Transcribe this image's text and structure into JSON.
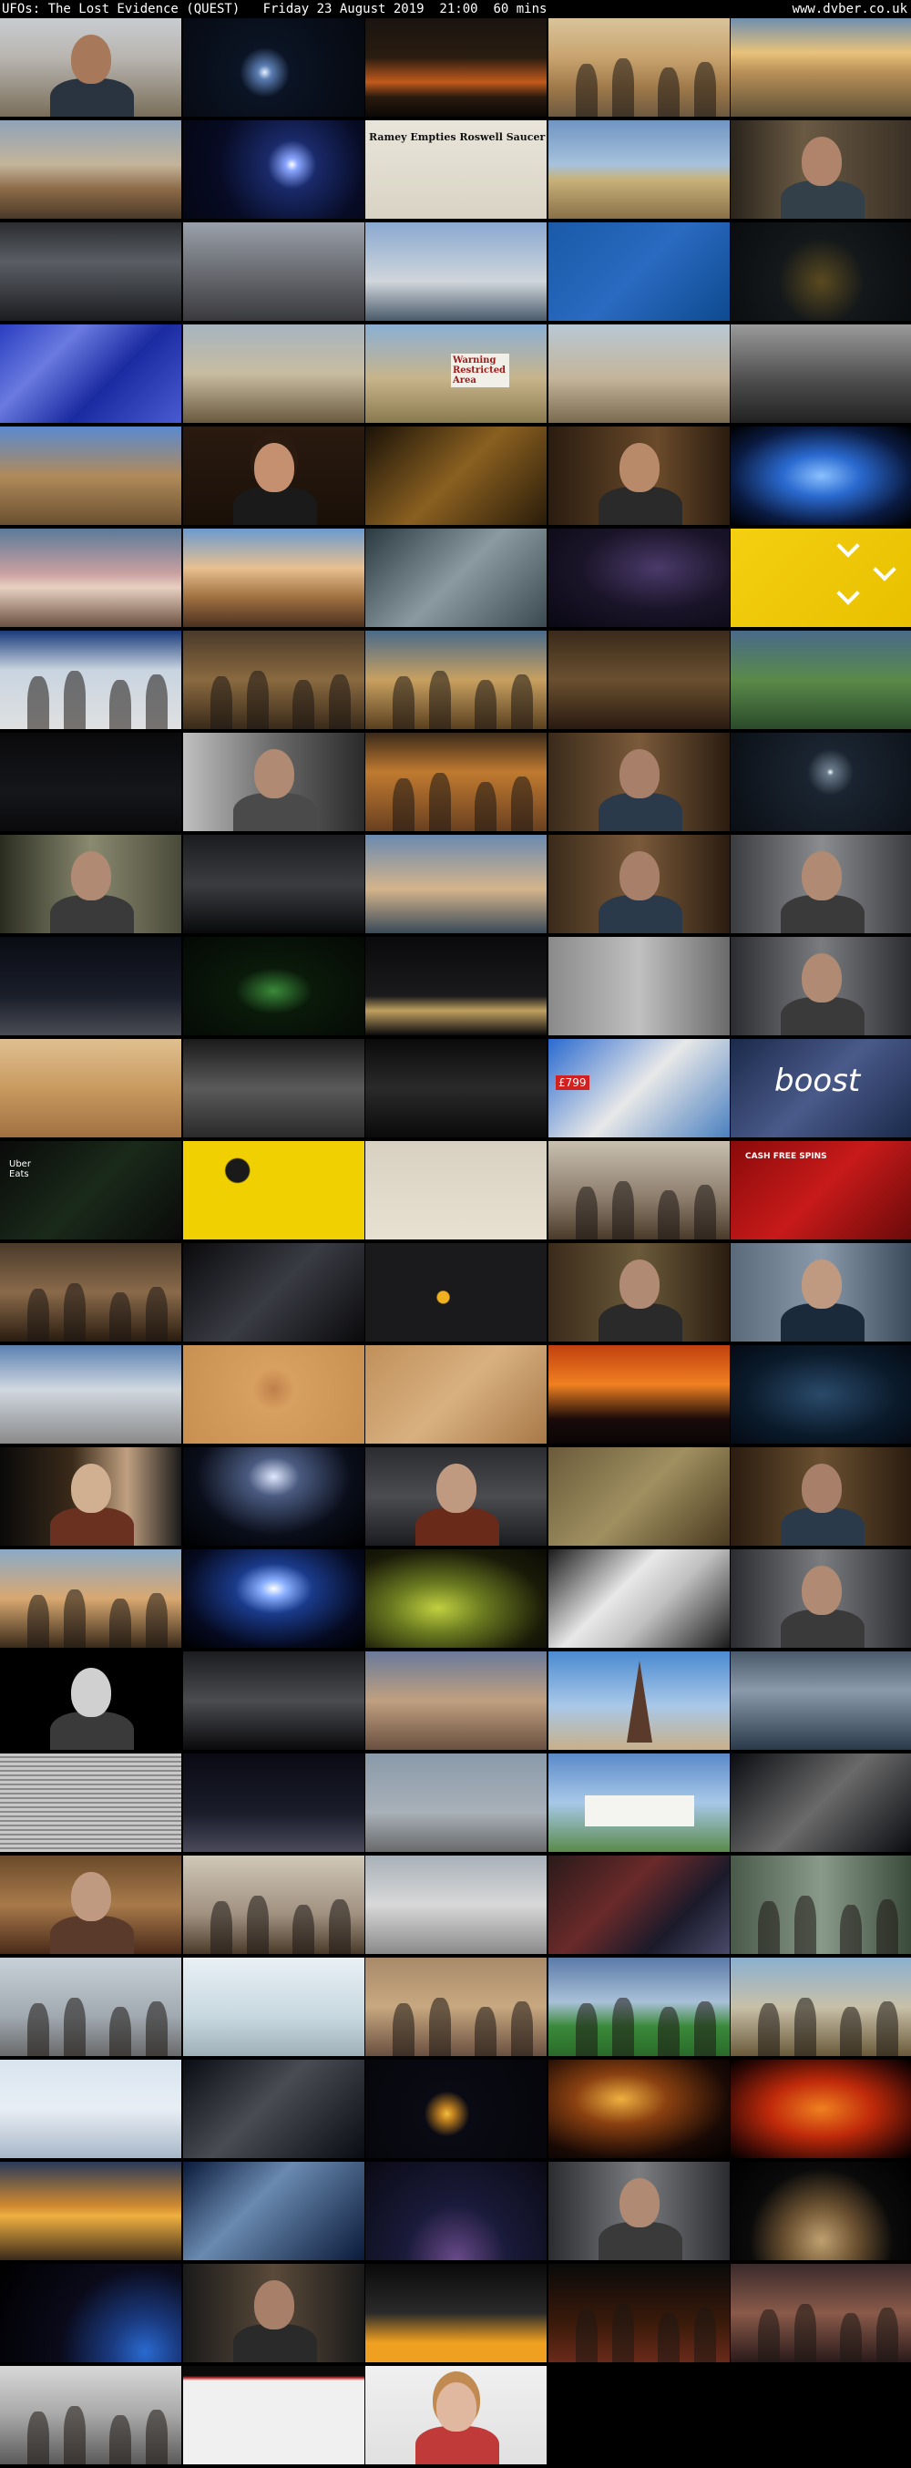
{
  "header": {
    "title": "UFOs: The Lost Evidence (QUEST)   Friday 23 August 2019  21:00  60 mins",
    "site": "www.dvber.co.uk"
  },
  "thumbnails": [
    {
      "bg": "linear-gradient(180deg,#c9ccd0 0%,#b8b5b0 40%,#7a6e5a 100%)",
      "kind": "face",
      "skin": "#a7785a",
      "shirt": "#2a3440"
    },
    {
      "bg": "radial-gradient(circle at 45% 55%,#e8f2ff 0%,#5c7fb5 6%,#0b1424 22%,#05080f 100%)"
    },
    {
      "bg": "linear-gradient(180deg,#1a1410 0%,#2a1c10 40%,#c25a1c 65%,#2a1a0e 80%,#0c0805 100%)"
    },
    {
      "bg": "linear-gradient(180deg,#d8c49a 0%,#c9a36e 40%,#a07a4a 70%,#6e5a40 100%)",
      "kind": "people"
    },
    {
      "bg": "linear-gradient(180deg,#6f8fb0 0%,#e8c27a 35%,#b88f58 55%,#5e5036 100%)"
    },
    {
      "bg": "linear-gradient(180deg,#8fa3b8 0%,#c4b49a 45%,#8c6a48 70%,#4a3a28 100%)"
    },
    {
      "bg": "radial-gradient(circle at 60% 45%,#ffffff 0%,#8aa6ff 5%,#1a2a6a 20%,#070b24 60%,#050714 100%)"
    },
    {
      "bg": "linear-gradient(180deg,#e9e5da 0%,#d8d3c4 100%)",
      "kind": "newspaper",
      "text": "Ramey Empties Roswell Saucer"
    },
    {
      "bg": "linear-gradient(180deg,#6f95c2 0%,#a6c2dc 45%,#c8b27a 60%,#8a7048 100%)"
    },
    {
      "bg": "linear-gradient(90deg,#2a241c 0%,#6a5a44 40%,#3a3026 100%)",
      "kind": "face",
      "skin": "#b0846a",
      "shirt": "#33404a"
    },
    {
      "bg": "linear-gradient(180deg,#2a2c30 0%,#5a5e64 40%,#1c1d20 100%)"
    },
    {
      "bg": "linear-gradient(180deg,#9aa0aa 0%,#6a6c72 50%,#3a3a3e 100%)"
    },
    {
      "bg": "linear-gradient(180deg,#8aa8d0 0%,#d0d6dc 60%,#4a5a6a 100%)"
    },
    {
      "bg": "linear-gradient(135deg,#1a5aa8 0%,#2a6ac0 50%,#0e4a90 100%)"
    },
    {
      "bg": "radial-gradient(circle at 50% 60%,#5a4a20 0%,#14181a 40%,#0a0c0e 100%)"
    },
    {
      "bg": "linear-gradient(135deg,#2a3ec0 0%,#6a7ae0 30%,#1a2aa0 60%,#4a5ad0 100%)"
    },
    {
      "bg": "linear-gradient(180deg,#a6b4c0 0%,#c8bca0 50%,#6a5a40 100%)"
    },
    {
      "bg": "linear-gradient(180deg,#8ab0d4 0%,#c8b48a 55%,#8a7a50 100%)",
      "kind": "sign",
      "text": "Warning Restricted Area"
    },
    {
      "bg": "linear-gradient(180deg,#b8c8d4 0%,#c4b49a 55%,#7a6a50 100%)"
    },
    {
      "bg": "linear-gradient(180deg,#9a9a9a 0%,#4a4a4a 60%,#222 100%)"
    },
    {
      "bg": "linear-gradient(180deg,#5a8ad0 0%,#b08a5a 50%,#6a5030 100%)"
    },
    {
      "bg": "linear-gradient(180deg,#2a1a10 0%,#1a1008 100%)",
      "kind": "face",
      "skin": "#c49070",
      "shirt": "#1a1a1a",
      "hair": "#2a1a10"
    },
    {
      "bg": "linear-gradient(135deg,#1a1208 0%,#8a6020 50%,#2a1c0a 100%)"
    },
    {
      "bg": "linear-gradient(90deg,#2a1c10 0%,#6a4a2a 60%,#2a1c10 100%)",
      "kind": "face",
      "skin": "#b88a6a",
      "shirt": "#2a2a2a"
    },
    {
      "bg": "radial-gradient(ellipse at 50% 50%,#8ac0ff 0%,#2a6ad0 30%,#0a1a40 70%,#000 100%)"
    },
    {
      "bg": "linear-gradient(180deg,#5a7a9a 0%,#c8a0a0 45%,#e8d0c0 60%,#6a5040 100%)"
    },
    {
      "bg": "linear-gradient(180deg,#6a9ad0 0%,#e8c090 40%,#a07040 70%,#4a3020 100%)"
    },
    {
      "bg": "linear-gradient(135deg,#2a3a40 0%,#8a9aa0 50%,#3a4a50 100%)"
    },
    {
      "bg": "radial-gradient(ellipse at 60% 40%,#4a3a6a 0%,#1a1428 50%,#0a0814 100%)"
    },
    {
      "bg": "linear-gradient(135deg,#f4d010 0%,#e8c000 100%)",
      "kind": "promo"
    },
    {
      "bg": "linear-gradient(180deg,#1a3a7a 0%,#c8d4e0 40%,#e0e0e0 100%)",
      "kind": "people"
    },
    {
      "bg": "linear-gradient(180deg,#4a3a2a 0%,#8a6a40 50%,#3a2a1a 100%)",
      "kind": "people"
    },
    {
      "bg": "linear-gradient(180deg,#4a6a8a 0%,#c8a060 50%,#5a4020 100%)",
      "kind": "people"
    },
    {
      "bg": "linear-gradient(180deg,#3a2a1a 0%,#6a5030 50%,#2a1a10 100%)"
    },
    {
      "bg": "linear-gradient(180deg,#4a6a8a 0%,#5a8a4a 50%,#2a4a2a 100%)"
    },
    {
      "bg": "linear-gradient(180deg,#0a0a0c 0%,#14161a 60%,#0a0a0c 100%)"
    },
    {
      "bg": "linear-gradient(90deg,#c0c0c0 0%,#6a6a6a 50%,#2a2a2a 100%)",
      "kind": "face",
      "skin": "#b08a72",
      "shirt": "#4a4a4a"
    },
    {
      "bg": "linear-gradient(180deg,#3a2a1a 0%,#c07a30 40%,#6a4020 100%)",
      "kind": "people"
    },
    {
      "bg": "linear-gradient(90deg,#3a2a1a 0%,#7a5a3a 50%,#2a1c10 100%)",
      "kind": "face",
      "skin": "#a8806a",
      "shirt": "#2a3a4a"
    },
    {
      "bg": "radial-gradient(circle at 55% 40%,#ffffff 0%,#6a7a8a 3%,#1a2430 20%,#0a0e14 100%)"
    },
    {
      "bg": "linear-gradient(90deg,#2a2c20 0%,#8a8a70 50%,#4a4a3a 100%)",
      "kind": "face",
      "skin": "#b08a72",
      "shirt": "#3a3a3a"
    },
    {
      "bg": "linear-gradient(180deg,#1a1c20 0%,#3a3c40 50%,#0a0a0c 100%)"
    },
    {
      "bg": "linear-gradient(180deg,#6a8ab0 0%,#d4b48a 55%,#3a4a5a 100%)"
    },
    {
      "bg": "linear-gradient(90deg,#3a2a1a 0%,#7a5a3a 50%,#2a1c10 100%)",
      "kind": "face",
      "skin": "#a8806a",
      "shirt": "#2a3a4a"
    },
    {
      "bg": "linear-gradient(90deg,#3a3c40 0%,#8a8c90 50%,#3a3c40 100%)",
      "kind": "face",
      "skin": "#b08a72",
      "shirt": "#3a3a3a"
    },
    {
      "bg": "linear-gradient(180deg,#0a0c14 0%,#1a1e2a 60%,#4a4c54 100%)"
    },
    {
      "bg": "radial-gradient(ellipse at 50% 55%,#3a8a3a 0%,#0a1a0a 30%,#050805 100%)"
    },
    {
      "bg": "linear-gradient(180deg,#0a0a0c 0%,#1a1a1c 60%,#c0a060 75%,#0a0a0c 100%)"
    },
    {
      "bg": "linear-gradient(90deg,#8a8a8a 0%,#c0c0c0 50%,#6a6a6a 100%)"
    },
    {
      "bg": "linear-gradient(90deg,#2a2c30 0%,#7a7c80 50%,#2a2c30 100%)",
      "kind": "face",
      "skin": "#b08a72",
      "shirt": "#3a3a3a"
    },
    {
      "bg": "linear-gradient(180deg,#e0c090 0%,#c89a60 50%,#a07040 100%)"
    },
    {
      "bg": "linear-gradient(180deg,#1a1a1a 0%,#5a5a5a 50%,#2a2a2a 100%)"
    },
    {
      "bg": "linear-gradient(180deg,#0a0a0a 0%,#2a2a2a 50%,#0a0a0a 100%)"
    },
    {
      "bg": "linear-gradient(135deg,#2a6ad0 0%,#e8e8e8 50%,#4a80c0 100%)",
      "kind": "price",
      "text": "£799"
    },
    {
      "bg": "linear-gradient(135deg,#1a2a4a 0%,#4a5a8a 50%,#1a2a4a 100%)",
      "kind": "boost",
      "text": "boost"
    },
    {
      "bg": "linear-gradient(135deg,#0a0a0a 0%,#1a2a1a 50%,#0a0a0a 100%)",
      "kind": "uber",
      "text": "Uber Eats"
    },
    {
      "bg": "radial-gradient(circle at 30% 30%,#1a1a1a 8%,transparent 9%),linear-gradient(135deg,#f0d000 0%,#f0d000 100%)"
    },
    {
      "bg": "linear-gradient(180deg,#d8d0c0 0%,#e8e0d0 100%)"
    },
    {
      "bg": "linear-gradient(180deg,#c8c0b0 0%,#8a7a6a 60%,#4a3a2a 100%)",
      "kind": "people"
    },
    {
      "bg": "linear-gradient(135deg,#8a0a0a 0%,#c81a1a 50%,#6a0a0a 100%)",
      "kind": "casino",
      "text": "CASH  FREE SPINS"
    },
    {
      "bg": "linear-gradient(180deg,#4a3a2a 0%,#8a6a4a 50%,#2a1c10 100%)",
      "kind": "people"
    },
    {
      "bg": "linear-gradient(135deg,#0a0a0c 0%,#3a3c44 50%,#0a0a0c 100%)"
    },
    {
      "bg": "radial-gradient(circle at 43% 55%,#f0b020 0%,#f0b020 5%,#1a1a1c 6%,#1a1a1c 100%)"
    },
    {
      "bg": "linear-gradient(90deg,#3a2a1a 0%,#6a5a3a 50%,#2a1c10 100%)",
      "kind": "face",
      "skin": "#b08a72",
      "shirt": "#2a2a2a"
    },
    {
      "bg": "linear-gradient(90deg,#5a6a7a 0%,#8a9aaa 50%,#3a4a5a 100%)",
      "kind": "face",
      "skin": "#c09a80",
      "shirt": "#1a2a3a"
    },
    {
      "bg": "linear-gradient(180deg,#5a80b0 0%,#d0d8e0 45%,#8a8a8a 100%)"
    },
    {
      "bg": "radial-gradient(circle at 50% 45%,#c0804a 0%,#d8a060 20%,#c89050 100%)"
    },
    {
      "bg": "linear-gradient(135deg,#c0905a 0%,#d8b080 50%,#a87848 100%)"
    },
    {
      "bg": "linear-gradient(180deg,#c04010 0%,#f08020 40%,#1a0a0a 75%,#0a0505 100%)"
    },
    {
      "bg": "radial-gradient(ellipse at 50% 50%,#2a4a6a 0%,#0a1a2a 60%,#050a14 100%)"
    },
    {
      "bg": "linear-gradient(90deg,#0a0a0a 0%,#3a2a1a 40%,#c0a080 70%,#1a1a1a 100%)",
      "kind": "face",
      "skin": "#d0b090",
      "shirt": "#6a3020"
    },
    {
      "bg": "radial-gradient(ellipse at 50% 30%,#e0e8ff 0%,#4a5a80 20%,#0a0e1a 60%,#000 100%)"
    },
    {
      "bg": "linear-gradient(180deg,#2a2c30 0%,#4a4c50 50%,#1a1c20 100%)",
      "kind": "face",
      "skin": "#c09a80",
      "shirt": "#6a2a1a"
    },
    {
      "bg": "linear-gradient(135deg,#6a5a3a 0%,#a09060 50%,#4a3a20 100%)"
    },
    {
      "bg": "linear-gradient(90deg,#2a1c10 0%,#6a5030 50%,#2a1c10 100%)",
      "kind": "face",
      "skin": "#a8806a",
      "shirt": "#2a3a4a"
    },
    {
      "bg": "linear-gradient(180deg,#8aaac8 0%,#d8a870 50%,#3a2a1a 100%)",
      "kind": "people"
    },
    {
      "bg": "radial-gradient(ellipse at 50% 40%,#ffffff 0%,#8ab0ff 10%,#1a3a8a 30%,#050a20 70%,#000 100%)"
    },
    {
      "bg": "radial-gradient(ellipse at 40% 60%,#c0d040 0%,#6a7a20 30%,#1a1a08 70%,#0a0a05 100%)"
    },
    {
      "bg": "linear-gradient(135deg,#1a1a1a 0%,#e8e8e8 40%,#c0c0c0 60%,#1a1a1a 100%)"
    },
    {
      "bg": "linear-gradient(90deg,#2a2c30 0%,#7a7c80 50%,#2a2c30 100%)",
      "kind": "face",
      "skin": "#b08a72",
      "shirt": "#3a3a3a"
    },
    {
      "bg": "linear-gradient(180deg,#000 0%,#000 100%)",
      "kind": "portrait",
      "skin": "#d0d0d0",
      "shirt": "#3a3a3a"
    },
    {
      "bg": "linear-gradient(180deg,#1a1c20 0%,#4a4c50 50%,#0a0a0c 100%)"
    },
    {
      "bg": "linear-gradient(180deg,#6a7a9a 0%,#c0a080 50%,#6a5040 100%)"
    },
    {
      "bg": "linear-gradient(180deg,#4a8ad0 0%,#a8c8e8 55%,#c8b08a 100%)",
      "kind": "tower"
    },
    {
      "bg": "linear-gradient(180deg,#4a5a6a 0%,#8a9aaa 40%,#2a3a4a 100%)"
    },
    {
      "bg": "repeating-linear-gradient(180deg,#c8c8c8 0px,#c8c8c8 3px,#8a8a8a 3px,#8a8a8a 5px)"
    },
    {
      "bg": "linear-gradient(180deg,#0a0a14 0%,#1a1c2a 60%,#4a4a5a 100%)"
    },
    {
      "bg": "linear-gradient(180deg,#8a9aaa 0%,#a8b0b8 60%,#6a6a6a 100%)"
    },
    {
      "bg": "linear-gradient(180deg,#5a8ac8 0%,#a8c8e8 50%,#5a8a4a 100%)",
      "kind": "house"
    },
    {
      "bg": "linear-gradient(135deg,#0a0c10 0%,#6a6a6a 50%,#0a0c10 100%)"
    },
    {
      "bg": "linear-gradient(180deg,#6a4a2a 0%,#a87a4a 50%,#4a2a1a 100%)",
      "kind": "face",
      "skin": "#c09a80",
      "shirt": "#5a3a2a"
    },
    {
      "bg": "linear-gradient(180deg,#d0c8b8 0%,#a09080 60%,#4a3a2a 100%)",
      "kind": "people"
    },
    {
      "bg": "linear-gradient(180deg,#a8b0b8 0%,#d8d8d8 50%,#8a8a8a 100%)"
    },
    {
      "bg": "linear-gradient(135deg,#2a1a1a 0%,#6a2a2a 40%,#1a1a2a 70%,#4a4a6a 100%)"
    },
    {
      "bg": "linear-gradient(90deg,#4a5a4a 0%,#8a9a8a 50%,#3a4a3a 100%)",
      "kind": "people"
    },
    {
      "bg": "linear-gradient(180deg,#c8d0d8 0%,#a0a8b0 60%,#6a6a6a 100%)",
      "kind": "people"
    },
    {
      "bg": "linear-gradient(180deg,#e8f0f4 0%,#c8d8e0 60%,#a0b0b8 100%)"
    },
    {
      "bg": "linear-gradient(180deg,#a88a6a 0%,#c8a880 50%,#6a5040 100%)",
      "kind": "people"
    },
    {
      "bg": "linear-gradient(180deg,#5a7aa8 0%,#a8c0d8 45%,#3a8a3a 70%,#2a6a2a 100%)",
      "kind": "people"
    },
    {
      "bg": "linear-gradient(180deg,#8ab0d0 0%,#c8c0a8 50%,#6a5a3a 100%)",
      "kind": "people"
    },
    {
      "bg": "linear-gradient(180deg,#d8e4f0 0%,#e8eef4 50%,#a8b8c8 100%)"
    },
    {
      "bg": "linear-gradient(135deg,#0a0c14 0%,#4a4c54 45%,#0a0c14 100%)"
    },
    {
      "bg": "radial-gradient(circle at 45% 55%,#f0c040 0%,#c08020 6%,#0a0a14 20%,#05050a 100%)"
    },
    {
      "bg": "radial-gradient(ellipse at 40% 40%,#f0b040 0%,#8a4010 30%,#1a0a05 70%,#000 100%)"
    },
    {
      "bg": "radial-gradient(ellipse at 50% 50%,#f08020 0%,#c02a0a 40%,#3a0a05 80%,#000 100%)"
    },
    {
      "bg": "linear-gradient(180deg,#2a3a5a 0%,#d08a30 45%,#f0b040 55%,#3a2a1a 100%)"
    },
    {
      "bg": "linear-gradient(135deg,#0a1a3a 0%,#6a8ab0 40%,#0a1a3a 100%)"
    },
    {
      "bg": "radial-gradient(ellipse at 50% 100%,#6a4a8a 0%,#1a1a3a 40%,#0a0a14 100%)"
    },
    {
      "bg": "linear-gradient(90deg,#2a2c30 0%,#7a7c80 50%,#2a2c30 100%)",
      "kind": "face",
      "skin": "#b08a72",
      "shirt": "#3a3a3a"
    },
    {
      "bg": "radial-gradient(circle at 50% 80%,#c0a070 0%,#6a5030 30%,#0a0a0a 60%,#000 100%)"
    },
    {
      "bg": "radial-gradient(circle at 80% 90%,#2a6ad0 0%,#1a3a80 20%,#0a0a1a 50%,#000 100%)"
    },
    {
      "bg": "linear-gradient(90deg,#1a1a1a 0%,#5a4a3a 50%,#1a1a1a 100%)",
      "kind": "face",
      "skin": "#a8806a",
      "shirt": "#2a2a2a"
    },
    {
      "bg": "linear-gradient(180deg,#0a0a0a 0%,#2a2a2a 50%,#f0a020 80%,#f0a020 100%)"
    },
    {
      "bg": "linear-gradient(180deg,#0a0a0a 0%,#3a1a0a 60%,#6a2a1a 100%)",
      "kind": "people"
    },
    {
      "bg": "linear-gradient(180deg,#3a2a2a 0%,#8a5a4a 50%,#2a1a1a 100%)",
      "kind": "people"
    },
    {
      "bg": "linear-gradient(180deg,#d8d8d8 0%,#a8a8a8 50%,#5a5a5a 100%)",
      "kind": "people"
    },
    {
      "bg": "linear-gradient(180deg,#0a0a0a 0%,#0a0a0a 10%,#c02a2a 12%,#f0f0f0 15%,#f0f0f0 100%)"
    },
    {
      "bg": "linear-gradient(180deg,#f0f0f0 0%,#e0e0e0 100%)",
      "kind": "face",
      "skin": "#e0b8a0",
      "shirt": "#c03a3a",
      "hair": "#c08a50"
    }
  ]
}
